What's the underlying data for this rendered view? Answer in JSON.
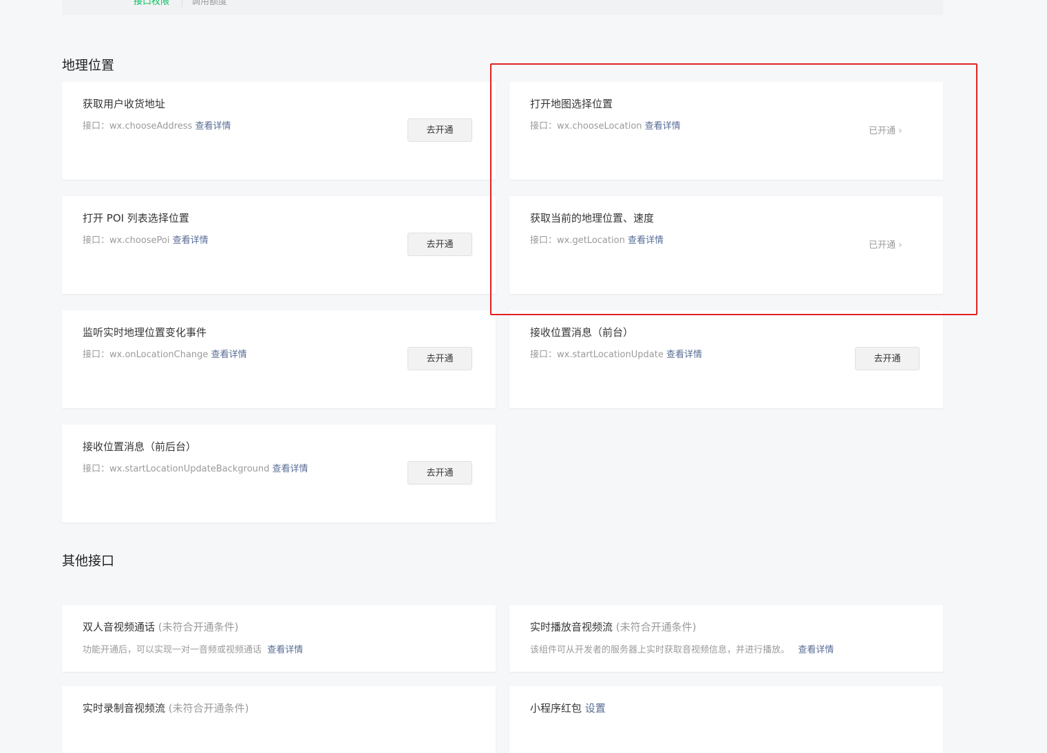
{
  "tabs": {
    "active": "接口权限",
    "inactive": "调用额度"
  },
  "sections": {
    "location": "地理位置",
    "others": "其他接口"
  },
  "common": {
    "iface_prefix": "接口：",
    "detail_link": "查看详情",
    "open_button": "去开通",
    "opened_status": "已开通"
  },
  "location_cards": [
    {
      "title": "获取用户收货地址",
      "api": "wx.chooseAddress",
      "state": "去开通"
    },
    {
      "title": "打开地图选择位置",
      "api": "wx.chooseLocation",
      "state": "已开通"
    },
    {
      "title": "打开 POI 列表选择位置",
      "api": "wx.choosePoi",
      "state": "去开通"
    },
    {
      "title": "获取当前的地理位置、速度",
      "api": "wx.getLocation",
      "state": "已开通"
    },
    {
      "title": "监听实时地理位置变化事件",
      "api": "wx.onLocationChange",
      "state": "去开通"
    },
    {
      "title": "接收位置消息（前台）",
      "api": "wx.startLocationUpdate",
      "state": "去开通"
    },
    {
      "title": "接收位置消息（前后台）",
      "api": "wx.startLocationUpdateBackground",
      "state": "去开通"
    }
  ],
  "other_cards": [
    {
      "title": "双人音视频通话",
      "condition": "(未符合开通条件)",
      "desc": "功能开通后，可以实现一对一音频或视频通话",
      "link": "查看详情"
    },
    {
      "title": "实时播放音视频流",
      "condition": "(未符合开通条件)",
      "desc": "该组件可从开发者的服务器上实时获取音视频信息，并进行播放。",
      "link": "查看详情"
    },
    {
      "title": "实时录制音视频流",
      "condition": "(未符合开通条件)",
      "desc": "",
      "link": ""
    },
    {
      "title": "小程序红包",
      "condition": "",
      "desc": "",
      "link": "设置"
    }
  ],
  "colors": {
    "accent": "#07c160",
    "link": "#576b95",
    "highlight": "#e02020"
  }
}
